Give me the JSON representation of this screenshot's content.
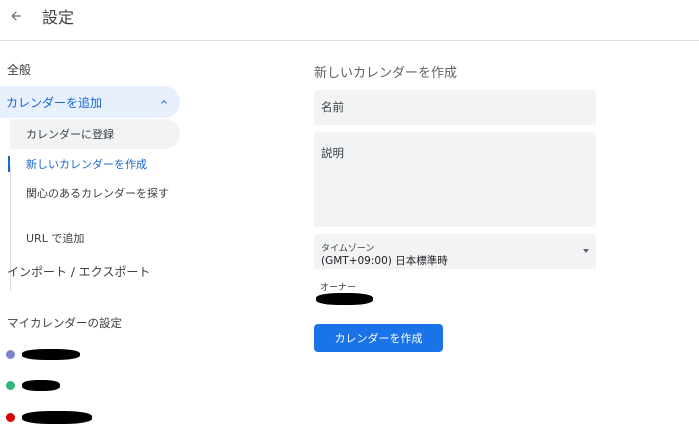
{
  "header": {
    "title": "設定"
  },
  "sidebar": {
    "general": "全般",
    "add_calendar": "カレンダーを追加",
    "add_submenu": [
      "カレンダーに登録",
      "新しいカレンダーを作成",
      "関心のあるカレンダーを探す",
      "URL で追加"
    ],
    "import_export": "インポート / エクスポート",
    "my_calendars_heading": "マイカレンダーの設定",
    "my_calendars": [
      {
        "color": "#7986cb",
        "name_redacted": true
      },
      {
        "color": "#33b679",
        "name_redacted": true
      },
      {
        "color": "#d50000",
        "name_redacted": true
      }
    ]
  },
  "main": {
    "title": "新しいカレンダーを作成",
    "name_placeholder": "名前",
    "description_placeholder": "説明",
    "timezone_label": "タイムゾーン",
    "timezone_value": "(GMT+09:00) 日本標準時",
    "owner_label": "オーナー",
    "create_button": "カレンダーを作成"
  },
  "colors": {
    "accent": "#1a73e8",
    "active_text": "#1967d2",
    "active_bg": "#e8f0fe",
    "field_bg": "#f1f3f4"
  }
}
